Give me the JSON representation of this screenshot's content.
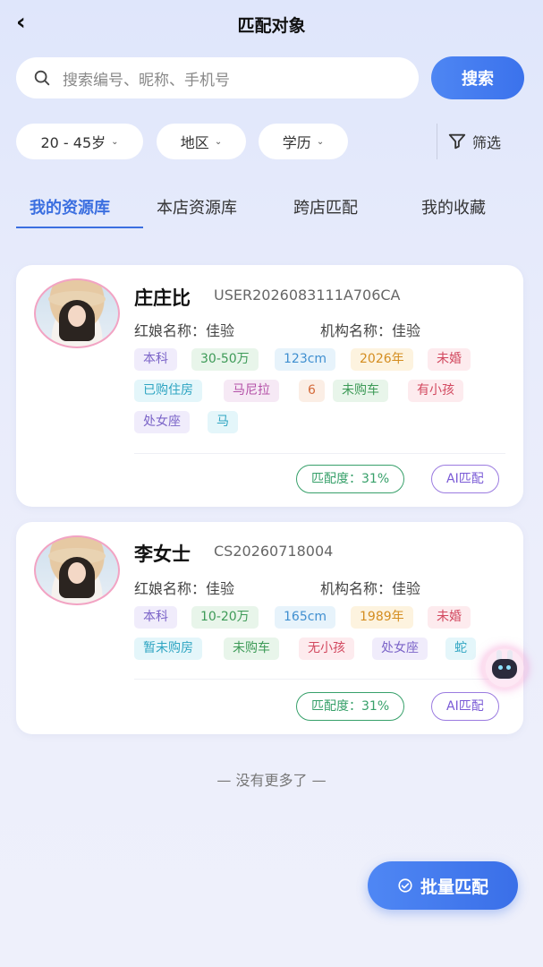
{
  "header": {
    "back_icon": "chevron-left-icon",
    "title": "匹配对象"
  },
  "search": {
    "placeholder": "搜索编号、昵称、手机号",
    "button_label": "搜索"
  },
  "filters": {
    "age": "20 - 45岁",
    "region": "地区",
    "education": "学历",
    "more_label": "筛选"
  },
  "tabs": [
    {
      "label": "我的资源库",
      "active": true
    },
    {
      "label": "本店资源库",
      "active": false
    },
    {
      "label": "跨店匹配",
      "active": false
    },
    {
      "label": "我的收藏",
      "active": false
    }
  ],
  "cards": [
    {
      "name": "庄庄比",
      "uid": "USER2026083111A706CA",
      "matchmaker": "红娘名称：佳验",
      "agency": "机构名称：佳验",
      "tags": [
        "本科",
        "30-50万",
        "123cm",
        "2026年",
        "未婚",
        "已购住房",
        "马尼拉",
        "6",
        "未购车",
        "有小孩",
        "处女座",
        "马"
      ],
      "match_rate": "匹配度：31%",
      "ai_label": "AI匹配"
    },
    {
      "name": "李女士",
      "uid": "CS20260718004",
      "matchmaker": "红娘名称：佳验",
      "agency": "机构名称：佳验",
      "tags": [
        "本科",
        "10-20万",
        "165cm",
        "1989年",
        "未婚",
        "暂未购房",
        "未购车",
        "无小孩",
        "处女座",
        "蛇"
      ],
      "match_rate": "匹配度：31%",
      "ai_label": "AI匹配"
    }
  ],
  "footer": {
    "no_more": "— 没有更多了 —",
    "batch_label": "批量匹配"
  },
  "colors": {
    "accent": "#3b6fe0",
    "match_green": "#37a06a",
    "ai_purple": "#7a5ad6"
  }
}
